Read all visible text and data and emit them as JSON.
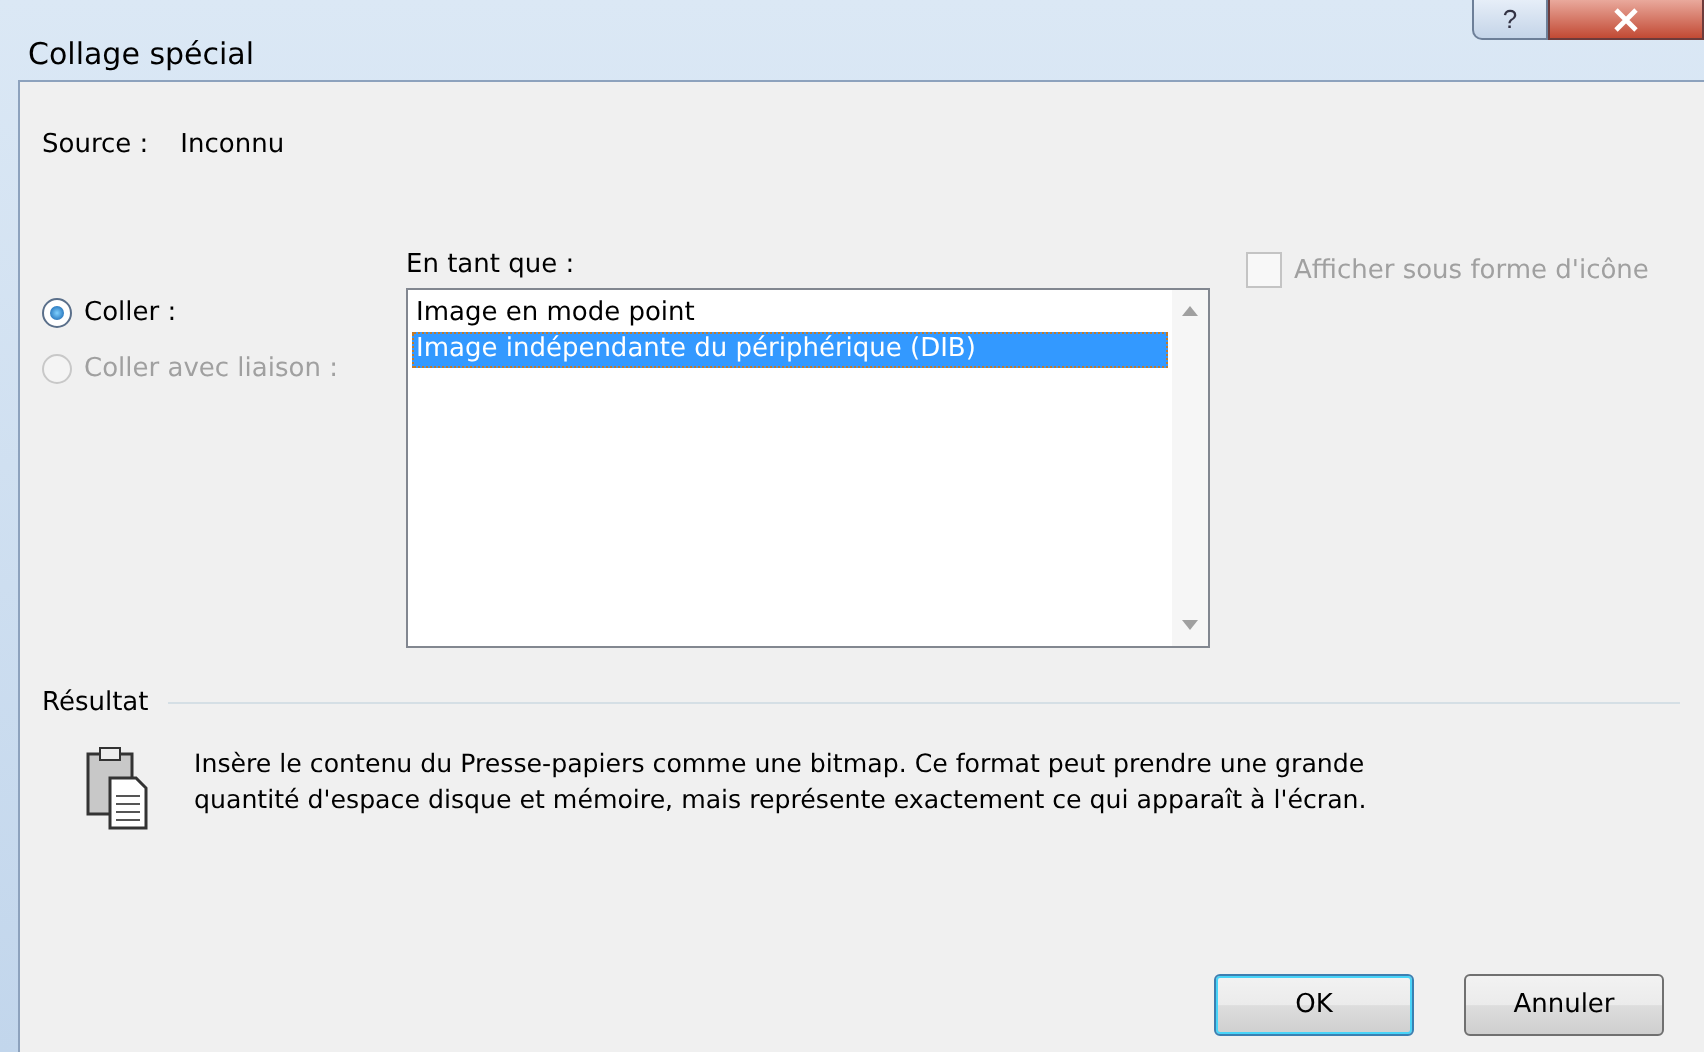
{
  "window": {
    "title": "Collage spécial",
    "help_button": "?"
  },
  "source": {
    "label": "Source :",
    "value": "Inconnu"
  },
  "paste_options": [
    {
      "label": "Coller :",
      "selected": true,
      "disabled": false
    },
    {
      "label": "Coller avec liaison :",
      "selected": false,
      "disabled": true
    }
  ],
  "format_list": {
    "label": "En tant que :",
    "items": [
      {
        "label": "Image en mode point",
        "selected": false
      },
      {
        "label": "Image indépendante du périphérique (DIB)",
        "selected": true
      }
    ]
  },
  "icon_checkbox": {
    "label": "Afficher sous forme d'icône",
    "checked": false,
    "disabled": true
  },
  "result": {
    "title": "Résultat",
    "lines": [
      "Insère le contenu du Presse-papiers comme une bitmap. Ce format peut prendre une grande",
      "quantité d'espace disque et mémoire, mais représente exactement ce qui apparaît à l'écran."
    ]
  },
  "buttons": [
    {
      "label": "OK",
      "default": true
    },
    {
      "label": "Annuler",
      "default": false
    }
  ]
}
